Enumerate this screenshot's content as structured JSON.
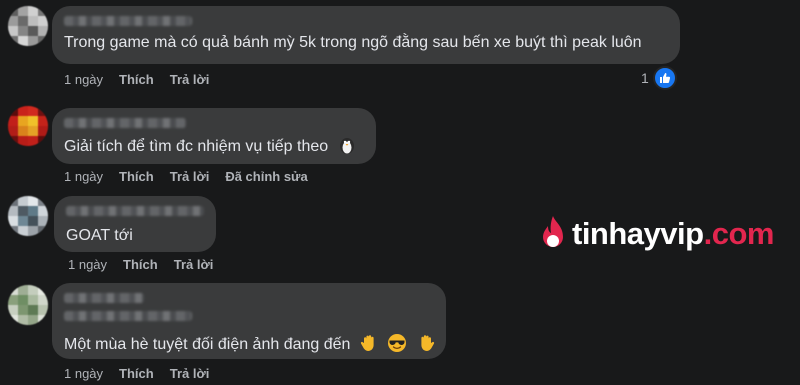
{
  "comments": [
    {
      "text": "Trong game mà có quả bánh mỳ 5k trong ngõ đằng sau bến xe buýt thì peak luôn",
      "time": "1 ngày",
      "like_label": "Thích",
      "reply_label": "Trả lời",
      "reaction_count": "1",
      "reaction_icon": "like-icon"
    },
    {
      "text": "Giải tích để tìm đc nhiệm vụ tiếp theo",
      "emoji": "penguin-icon",
      "time": "1 ngày",
      "like_label": "Thích",
      "reply_label": "Trả lời",
      "edited_label": "Đã chỉnh sửa"
    },
    {
      "text": "GOAT tới",
      "time": "1 ngày",
      "like_label": "Thích",
      "reply_label": "Trả lời"
    },
    {
      "text": "Một mùa hè tuyệt đối điện ảnh đang đến",
      "emojis": [
        "raised-hand-icon",
        "sunglasses-face-icon",
        "raised-hand-icon"
      ],
      "time": "1 ngày",
      "like_label": "Thích",
      "reply_label": "Trả lời"
    }
  ],
  "watermark": {
    "brand_main": "tinhayvip",
    "brand_suffix": ".com",
    "logo_icon": "fire-icon"
  },
  "colors": {
    "background": "#18191a",
    "bubble": "#3a3b3c",
    "text": "#e4e6eb",
    "meta": "#b0b3b8",
    "like_blue": "#1877f2",
    "brand_red": "#e2264e"
  }
}
